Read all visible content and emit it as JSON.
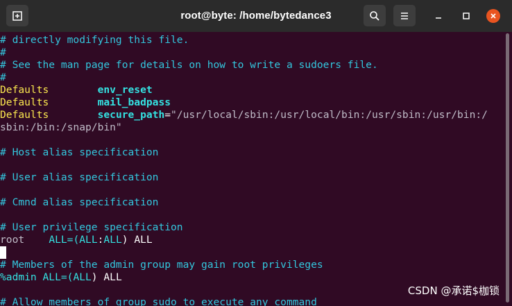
{
  "window": {
    "title": "root@byte: /home/bytedance3",
    "new_tab_icon": "new-tab-icon",
    "search_icon": "search-icon",
    "menu_icon": "hamburger-menu-icon",
    "minimize_icon": "minimize-icon",
    "maximize_icon": "maximize-icon",
    "close_icon": "close-icon",
    "close_color": "#e95420"
  },
  "terminal": {
    "l1": "# directly modifying this file.",
    "l2": "#",
    "l3": "# See the man page for details on how to write a sudoers file.",
    "l4": "#",
    "l5_kw": "Defaults",
    "l5_val": "env_reset",
    "l6_kw": "Defaults",
    "l6_val": "mail_badpass",
    "l7_kw": "Defaults",
    "l7_key": "secure_path",
    "l7_eq": "=",
    "l7_str": "\"/usr/local/sbin:/usr/local/bin:/usr/sbin:/usr/bin:/",
    "l8_str": "sbin:/bin:/snap/bin\"",
    "l9": "",
    "l10": "# Host alias specification",
    "l11": "",
    "l12": "# User alias specification",
    "l13": "",
    "l14": "# Cmnd alias specification",
    "l15": "",
    "l16": "# User privilege specification",
    "l17_user": "root",
    "l17_a": "ALL=(",
    "l17_b": "ALL",
    "l17_c": ":",
    "l17_d": "ALL",
    "l17_e": ") ALL",
    "l18": "",
    "l19": "# Members of the admin group may gain root privileges",
    "l20_a": "%admin ALL=(",
    "l20_b": "ALL",
    "l20_c": ") ALL",
    "l21": "",
    "l22": "# Allow members of group sudo to execute any command"
  },
  "watermark": "CSDN @承诺$枷锁"
}
